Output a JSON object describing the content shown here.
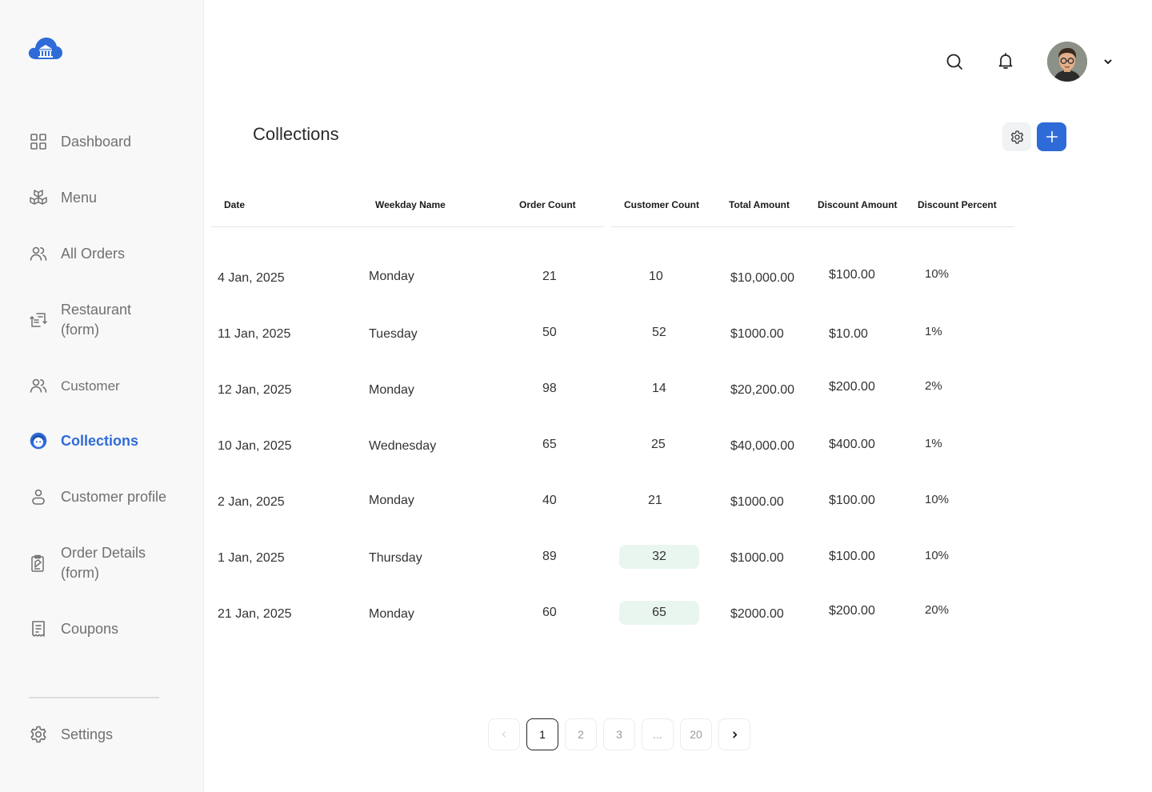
{
  "brand": {
    "logo_icon": "cloud-bank-icon",
    "accent": "#2f6bd8"
  },
  "sidebar": {
    "items": [
      {
        "label": "Dashboard",
        "icon": "grid-icon"
      },
      {
        "label": "Menu",
        "icon": "boxes-icon"
      },
      {
        "label": "All Orders",
        "icon": "users-icon"
      },
      {
        "label": "Restaurant (form)",
        "icon": "swap-form-icon"
      },
      {
        "label": "Customer",
        "icon": "users-icon"
      },
      {
        "label": "Collections",
        "icon": "collections-face-icon",
        "active": true
      },
      {
        "label": "Customer profile",
        "icon": "person-icon"
      },
      {
        "label": "Order Details (form)",
        "icon": "order-doc-icon"
      },
      {
        "label": "Coupons",
        "icon": "receipt-icon"
      }
    ],
    "settings_label": "Settings"
  },
  "header": {
    "search_icon": "search-icon",
    "bell_icon": "bell-icon",
    "avatar": "user-avatar"
  },
  "page": {
    "title": "Collections"
  },
  "table": {
    "columns": [
      "Date",
      "Weekday Name",
      "Order Count",
      "Customer Count",
      "Total Amount",
      "Discount Amount",
      "Discount Percent"
    ],
    "rows": [
      {
        "date": "4 Jan, 2025",
        "weekday": "Monday",
        "orders": "21",
        "customers": "10",
        "total": "$10,000.00",
        "discount": "$100.00",
        "percent": "10%",
        "highlight": false
      },
      {
        "date": "11 Jan, 2025",
        "weekday": "Tuesday",
        "orders": "50",
        "customers": "52",
        "total": "$1000.00",
        "discount": "$10.00",
        "percent": "1%",
        "highlight": false
      },
      {
        "date": "12 Jan, 2025",
        "weekday": "Monday",
        "orders": "98",
        "customers": "14",
        "total": "$20,200.00",
        "discount": "$200.00",
        "percent": "2%",
        "highlight": false
      },
      {
        "date": "10 Jan, 2025",
        "weekday": "Wednesday",
        "orders": "65",
        "customers": "25",
        "total": "$40,000.00",
        "discount": "$400.00",
        "percent": "1%",
        "highlight": false
      },
      {
        "date": "2 Jan, 2025",
        "weekday": "Monday",
        "orders": "40",
        "customers": "21",
        "total": "$1000.00",
        "discount": "$100.00",
        "percent": "10%",
        "highlight": false
      },
      {
        "date": "1 Jan, 2025",
        "weekday": "Thursday",
        "orders": "89",
        "customers": "32",
        "total": "$1000.00",
        "discount": "$100.00",
        "percent": "10%",
        "highlight": true
      },
      {
        "date": "21 Jan, 2025",
        "weekday": "Monday",
        "orders": "60",
        "customers": "65",
        "total": "$2000.00",
        "discount": "$200.00",
        "percent": "20%",
        "highlight": true
      }
    ]
  },
  "pagination": {
    "pages": [
      "1",
      "2",
      "3",
      "...",
      "20"
    ],
    "current": "1"
  }
}
